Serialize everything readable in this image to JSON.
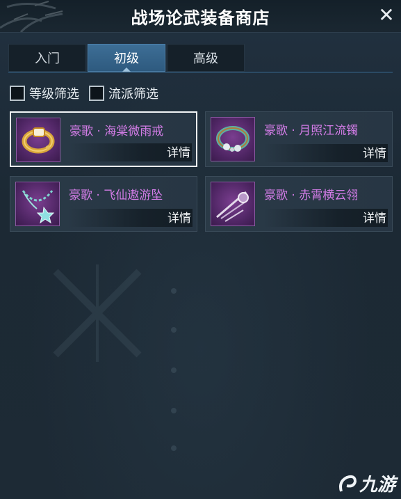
{
  "window": {
    "title": "战场论武装备商店",
    "close_icon": "close-icon"
  },
  "tabs": [
    {
      "label": "入门",
      "active": false
    },
    {
      "label": "初级",
      "active": true
    },
    {
      "label": "高级",
      "active": false
    }
  ],
  "filters": [
    {
      "label": "等级筛选",
      "checked": false
    },
    {
      "label": "流派筛选",
      "checked": false
    }
  ],
  "items": [
    {
      "name": "豪歌 · 海棠微雨戒",
      "detail_label": "详情",
      "icon": "gold-ring-icon",
      "selected": true
    },
    {
      "name": "豪歌 · 月照江流镯",
      "detail_label": "详情",
      "icon": "jade-bracelet-icon",
      "selected": false
    },
    {
      "name": "豪歌 · 飞仙遨游坠",
      "detail_label": "详情",
      "icon": "pendant-necklace-icon",
      "selected": false
    },
    {
      "name": "豪歌 · 赤霄横云翎",
      "detail_label": "详情",
      "icon": "feather-ornament-icon",
      "selected": false
    }
  ],
  "colors": {
    "item_name": "#d27ce6",
    "tab_active": "#3d6e96",
    "background": "#1e2b37"
  },
  "watermark": {
    "text": "九游"
  }
}
